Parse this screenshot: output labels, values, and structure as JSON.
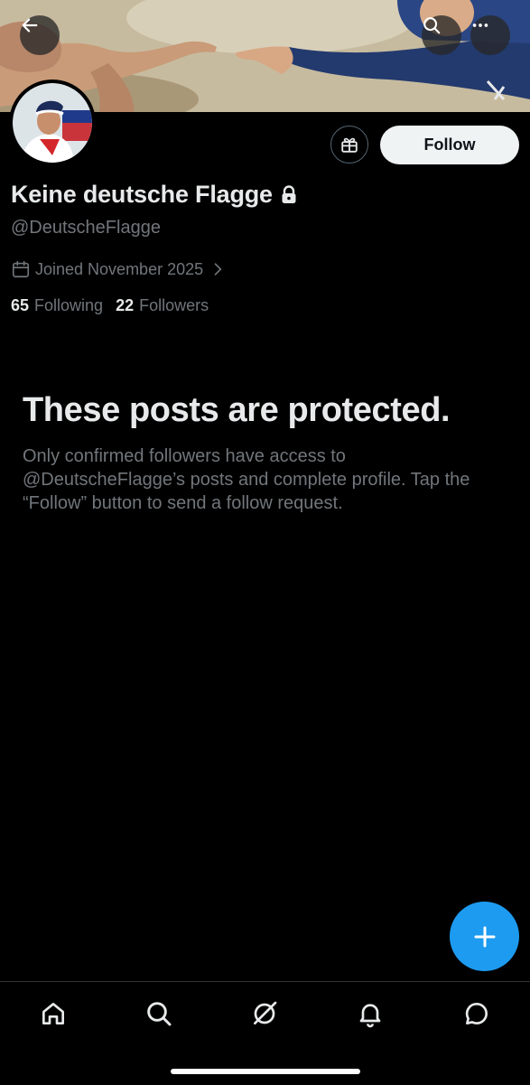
{
  "header": {
    "back_icon": "arrow-left-icon",
    "search_icon": "search-icon",
    "more_icon": "more-horizontal-icon"
  },
  "profile": {
    "display_name": "Keine deutsche Flagge",
    "handle": "@DeutscheFlagge",
    "joined": "Joined November 2025",
    "following_count": "65",
    "following_label": "Following",
    "followers_count": "22",
    "followers_label": "Followers",
    "follow_label": "Follow"
  },
  "protected": {
    "title": "These posts are protected.",
    "body": "Only confirmed followers have access to @DeutscheFlagge’s posts and complete profile. Tap the “Follow” button to send a follow request."
  },
  "nav": [
    "home-icon",
    "search-icon",
    "grok-icon",
    "notifications-icon",
    "messages-icon"
  ],
  "colors": {
    "background": "#000000",
    "accent": "#1d9bf0",
    "text_primary": "#e7e9ea",
    "text_secondary": "#71767b"
  }
}
